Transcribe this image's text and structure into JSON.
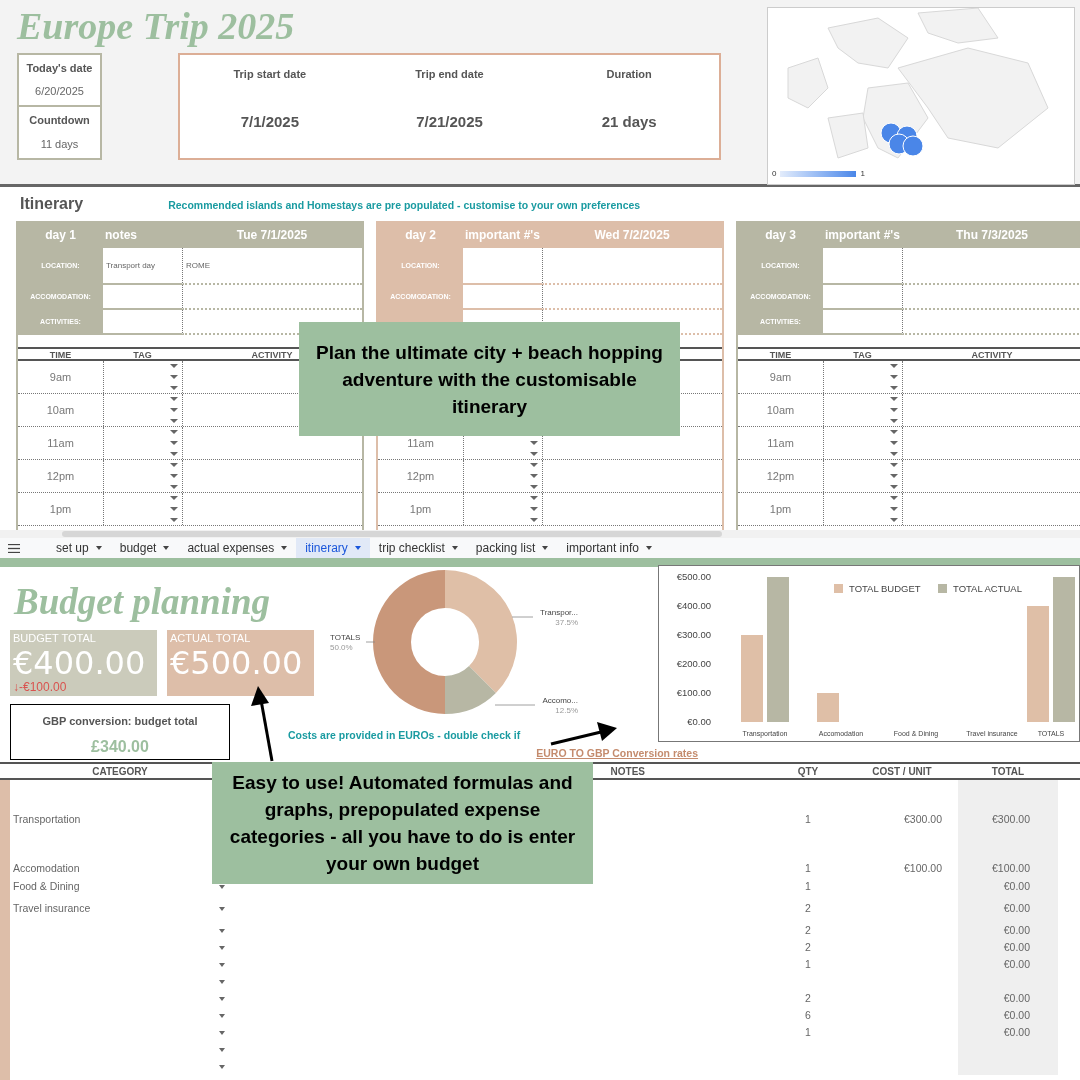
{
  "header": {
    "title": "Europe Trip 2025",
    "today_label": "Today's date",
    "today": "6/20/2025",
    "countdown_label": "Countdown",
    "countdown": "11 days",
    "trip": [
      {
        "label": "Trip start date",
        "value": "7/1/2025"
      },
      {
        "label": "Trip end date",
        "value": "7/21/2025"
      },
      {
        "label": "Duration",
        "value": "21 days"
      }
    ],
    "map": {
      "legend_min": "0",
      "legend_max": "1"
    }
  },
  "itinerary": {
    "title": "Itinerary",
    "note": "Recommended islands and Homestays are pre populated - customise to your own preferences",
    "days": [
      {
        "day": "day 1",
        "column_2": "notes",
        "date": "Tue 7/1/2025",
        "color": "#b7b7a4",
        "info": [
          {
            "label": "LOCATION:",
            "values": [
              "Transport day",
              "ROME"
            ]
          },
          {
            "label": "ACCOMODATION:"
          },
          {
            "label": "ACTIVITIES:"
          }
        ],
        "table_headers": [
          "TIME",
          "TAG",
          "ACTIVITY"
        ],
        "rows": [
          {
            "time": "9am"
          },
          {
            "time": "10am"
          },
          {
            "time": "11am"
          },
          {
            "time": "12pm"
          },
          {
            "time": "1pm"
          }
        ]
      },
      {
        "day": "day 2",
        "column_2": "important #'s",
        "date": "Wed 7/2/2025",
        "color": "#ddbea9",
        "info": [
          {
            "label": "LOCATION:"
          },
          {
            "label": "ACCOMODATION:"
          }
        ],
        "rows": [
          {},
          {},
          {
            "time": "11am"
          },
          {
            "time": "12pm"
          },
          {
            "time": "1pm"
          }
        ]
      },
      {
        "day": "day 3",
        "column_2": "important #'s",
        "date": "Thu 7/3/2025",
        "color": "#b7b7a4",
        "info": [
          {
            "label": "LOCATION:"
          },
          {
            "label": "ACCOMODATION:"
          },
          {
            "label": "ACTIVITIES:"
          }
        ],
        "table_headers": [
          "TIME",
          "TAG",
          "ACTIVITY"
        ],
        "rows": [
          {
            "time": "9am"
          },
          {
            "time": "10am"
          },
          {
            "time": "11am"
          },
          {
            "time": "12pm"
          },
          {
            "time": "1pm"
          }
        ]
      }
    ]
  },
  "tabs": [
    {
      "label": "set up",
      "selected": false
    },
    {
      "label": "budget",
      "selected": false
    },
    {
      "label": "actual expenses",
      "selected": false
    },
    {
      "label": "itinerary",
      "selected": true
    },
    {
      "label": "trip checklist",
      "selected": false
    },
    {
      "label": "packing list",
      "selected": false
    },
    {
      "label": "important info",
      "selected": false
    }
  ],
  "budget": {
    "title": "Budget planning",
    "budget_total": {
      "label": "BUDGET TOTAL",
      "value": "€400.00",
      "difference": "↓-€100.00"
    },
    "actual_total": {
      "label": "ACTUAL TOTAL",
      "value": "€500.00"
    },
    "gbp": {
      "label": "GBP conversion: budget total",
      "value": "£340.00"
    },
    "note": "Costs are provided in EUROs - double check if",
    "link": "EURO TO GBP Conversion rates",
    "donut": {
      "chart_data": {
        "type": "donut",
        "categories": [
          "Transpor...",
          "Accomo...",
          "TOTALS"
        ],
        "values": [
          37.5,
          12.5,
          50
        ],
        "colors": [
          "#dfbfa7",
          "#b7b7a4",
          "#c9977a"
        ],
        "value_labels": [
          "37.5%",
          "12.5%",
          "50.0%"
        ]
      }
    },
    "bars": {
      "chart_data": {
        "type": "bar",
        "legend": "top",
        "categories": [
          "Transportation",
          "Accomodation",
          "Food & Dining",
          "Travel insurance",
          "TOTALS"
        ],
        "series": [
          {
            "name": "TOTAL BUDGET",
            "color": "#dfbfa7",
            "values": [
              300,
              100,
              0,
              0,
              400
            ]
          },
          {
            "name": "TOTAL ACTUAL",
            "color": "#b7b7a4",
            "values": [
              500,
              0,
              0,
              0,
              500
            ]
          }
        ],
        "ylim": [
          0,
          500
        ],
        "yticks": [
          {
            "value": 0,
            "label": "€0.00"
          },
          {
            "value": 100,
            "label": "€100.00"
          },
          {
            "value": 200,
            "label": "€200.00"
          },
          {
            "value": 300,
            "label": "€300.00"
          },
          {
            "value": 400,
            "label": "€400.00"
          },
          {
            "value": 500,
            "label": "€500.00"
          }
        ]
      }
    }
  },
  "table": {
    "columns": [
      "CATEGORY",
      "NOTES",
      "QTY",
      "COST / UNIT",
      "TOTAL"
    ],
    "rows": [
      {
        "category": "Transportation",
        "qty": "1",
        "cost": "€300.00",
        "total": "€300.00",
        "dropdown": false
      },
      {
        "category": "Accomodation",
        "qty": "1",
        "cost": "€100.00",
        "total": "€100.00",
        "dropdown": false
      },
      {
        "category": "Food & Dining",
        "qty": "1",
        "total": "€0.00",
        "dropdown": true
      },
      {
        "category": "Travel insurance",
        "qty": "2",
        "total": "€0.00",
        "dropdown": true
      },
      {
        "qty": "2",
        "total": "€0.00",
        "dropdown": true
      },
      {
        "qty": "2",
        "total": "€0.00",
        "dropdown": true
      },
      {
        "qty": "1",
        "total": "€0.00",
        "dropdown": true
      },
      {
        "dropdown": true
      },
      {
        "qty": "2",
        "total": "€0.00",
        "dropdown": true
      },
      {
        "qty": "6",
        "total": "€0.00",
        "dropdown": true
      },
      {
        "qty": "1",
        "total": "€0.00",
        "dropdown": true
      },
      {
        "dropdown": true
      },
      {
        "dropdown": true
      }
    ]
  },
  "callouts": [
    {
      "text": "Plan the ultimate city + beach hopping adventure with the customisable itinerary"
    },
    {
      "text": "Easy to use! Automated formulas and graphs, prepopulated expense categories - all you have to do is enter your own budget"
    }
  ]
}
